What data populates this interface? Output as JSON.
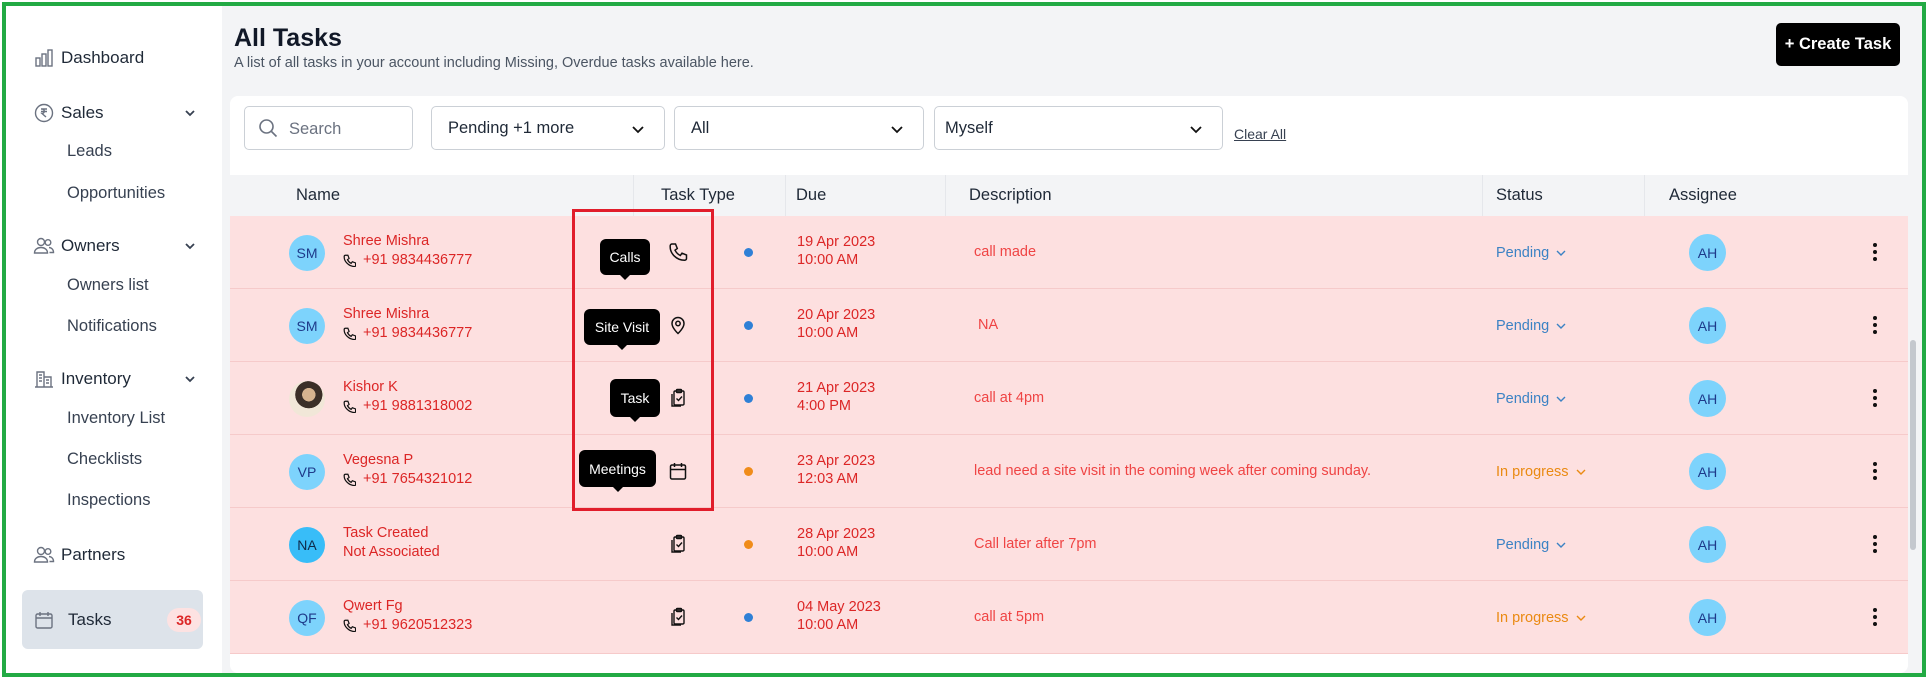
{
  "sidebar": {
    "dashboard": "Dashboard",
    "sales": "Sales",
    "leads": "Leads",
    "opportunities": "Opportunities",
    "owners": "Owners",
    "owners_list": "Owners list",
    "notifications": "Notifications",
    "inventory": "Inventory",
    "inventory_list": "Inventory List",
    "checklists": "Checklists",
    "inspections": "Inspections",
    "partners": "Partners",
    "tasks": "Tasks",
    "tasks_count": "36"
  },
  "header": {
    "title": "All Tasks",
    "subtitle": "A list of all tasks in your account including Missing, Overdue tasks available here.",
    "create_button": "+ Create Task"
  },
  "filters": {
    "search_placeholder": "Search",
    "status_filter": "Pending +1 more",
    "type_filter": "All",
    "owner_filter": "Myself",
    "clear_all": "Clear All"
  },
  "table": {
    "columns": [
      "Name",
      "Task Type",
      "Due",
      "Description",
      "Status",
      "Assignee"
    ],
    "rows": [
      {
        "initials": "SM",
        "name": "Shree Mishra",
        "phone": "+91 9834436777",
        "type_icon": "phone-icon",
        "dot_color": "#2f80d6",
        "due_date": "19 Apr 2023",
        "due_time": "10:00 AM",
        "description": "call made",
        "status": "Pending",
        "status_color": "#3b82c4",
        "assignee": "AH"
      },
      {
        "initials": "SM",
        "name": "Shree Mishra",
        "phone": "+91 9834436777",
        "type_icon": "location-pin-icon",
        "dot_color": "#2f80d6",
        "due_date": "20 Apr 2023",
        "due_time": "10:00 AM",
        "description": "NA",
        "status": "Pending",
        "status_color": "#3b82c4",
        "assignee": "AH"
      },
      {
        "initials": "",
        "name": "Kishor K",
        "phone": "+91 9881318002",
        "type_icon": "clipboard-icon",
        "dot_color": "#2f80d6",
        "due_date": "21 Apr 2023",
        "due_time": "4:00 PM",
        "description": "call at 4pm",
        "status": "Pending",
        "status_color": "#3b82c4",
        "assignee": "AH"
      },
      {
        "initials": "VP",
        "name": "Vegesna P",
        "phone": "+91 7654321012",
        "type_icon": "calendar-icon",
        "dot_color": "#f08c1a",
        "due_date": "23 Apr 2023",
        "due_time": "12:03 AM",
        "description": "lead need a site visit in the coming week after coming sunday.",
        "status": "In progress",
        "status_color": "#ea8a12",
        "assignee": "AH"
      },
      {
        "initials": "NA",
        "name": "Task Created",
        "phone": "Not Associated",
        "type_icon": "clipboard-icon",
        "dot_color": "#f08c1a",
        "due_date": "28 Apr 2023",
        "due_time": "10:00 AM",
        "description": "Call later after 7pm",
        "status": "Pending",
        "status_color": "#3b82c4",
        "assignee": "AH"
      },
      {
        "initials": "QF",
        "name": "Qwert Fg",
        "phone": "+91 9620512323",
        "type_icon": "clipboard-icon",
        "dot_color": "#2f80d6",
        "due_date": "04 May 2023",
        "due_time": "10:00 AM",
        "description": "call at 5pm",
        "status": "In progress",
        "status_color": "#ea8a12",
        "assignee": "AH"
      }
    ]
  },
  "tooltips": {
    "calls": "Calls",
    "site_visit": "Site Visit",
    "task": "Task",
    "meetings": "Meetings"
  },
  "colors": {
    "row_background": "#fde0e0",
    "overdue_text": "#dc2626",
    "highlight_border": "#e11d2b",
    "frame_border": "#22aa44"
  }
}
